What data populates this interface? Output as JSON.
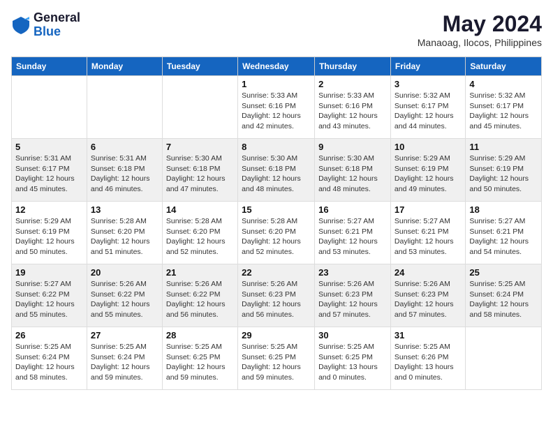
{
  "logo": {
    "general": "General",
    "blue": "Blue"
  },
  "title": "May 2024",
  "subtitle": "Manaoag, Ilocos, Philippines",
  "weekdays": [
    "Sunday",
    "Monday",
    "Tuesday",
    "Wednesday",
    "Thursday",
    "Friday",
    "Saturday"
  ],
  "rows": [
    [
      {
        "day": "",
        "info": ""
      },
      {
        "day": "",
        "info": ""
      },
      {
        "day": "",
        "info": ""
      },
      {
        "day": "1",
        "info": "Sunrise: 5:33 AM\nSunset: 6:16 PM\nDaylight: 12 hours and 42 minutes."
      },
      {
        "day": "2",
        "info": "Sunrise: 5:33 AM\nSunset: 6:16 PM\nDaylight: 12 hours and 43 minutes."
      },
      {
        "day": "3",
        "info": "Sunrise: 5:32 AM\nSunset: 6:17 PM\nDaylight: 12 hours and 44 minutes."
      },
      {
        "day": "4",
        "info": "Sunrise: 5:32 AM\nSunset: 6:17 PM\nDaylight: 12 hours and 45 minutes."
      }
    ],
    [
      {
        "day": "5",
        "info": "Sunrise: 5:31 AM\nSunset: 6:17 PM\nDaylight: 12 hours and 45 minutes."
      },
      {
        "day": "6",
        "info": "Sunrise: 5:31 AM\nSunset: 6:18 PM\nDaylight: 12 hours and 46 minutes."
      },
      {
        "day": "7",
        "info": "Sunrise: 5:30 AM\nSunset: 6:18 PM\nDaylight: 12 hours and 47 minutes."
      },
      {
        "day": "8",
        "info": "Sunrise: 5:30 AM\nSunset: 6:18 PM\nDaylight: 12 hours and 48 minutes."
      },
      {
        "day": "9",
        "info": "Sunrise: 5:30 AM\nSunset: 6:18 PM\nDaylight: 12 hours and 48 minutes."
      },
      {
        "day": "10",
        "info": "Sunrise: 5:29 AM\nSunset: 6:19 PM\nDaylight: 12 hours and 49 minutes."
      },
      {
        "day": "11",
        "info": "Sunrise: 5:29 AM\nSunset: 6:19 PM\nDaylight: 12 hours and 50 minutes."
      }
    ],
    [
      {
        "day": "12",
        "info": "Sunrise: 5:29 AM\nSunset: 6:19 PM\nDaylight: 12 hours and 50 minutes."
      },
      {
        "day": "13",
        "info": "Sunrise: 5:28 AM\nSunset: 6:20 PM\nDaylight: 12 hours and 51 minutes."
      },
      {
        "day": "14",
        "info": "Sunrise: 5:28 AM\nSunset: 6:20 PM\nDaylight: 12 hours and 52 minutes."
      },
      {
        "day": "15",
        "info": "Sunrise: 5:28 AM\nSunset: 6:20 PM\nDaylight: 12 hours and 52 minutes."
      },
      {
        "day": "16",
        "info": "Sunrise: 5:27 AM\nSunset: 6:21 PM\nDaylight: 12 hours and 53 minutes."
      },
      {
        "day": "17",
        "info": "Sunrise: 5:27 AM\nSunset: 6:21 PM\nDaylight: 12 hours and 53 minutes."
      },
      {
        "day": "18",
        "info": "Sunrise: 5:27 AM\nSunset: 6:21 PM\nDaylight: 12 hours and 54 minutes."
      }
    ],
    [
      {
        "day": "19",
        "info": "Sunrise: 5:27 AM\nSunset: 6:22 PM\nDaylight: 12 hours and 55 minutes."
      },
      {
        "day": "20",
        "info": "Sunrise: 5:26 AM\nSunset: 6:22 PM\nDaylight: 12 hours and 55 minutes."
      },
      {
        "day": "21",
        "info": "Sunrise: 5:26 AM\nSunset: 6:22 PM\nDaylight: 12 hours and 56 minutes."
      },
      {
        "day": "22",
        "info": "Sunrise: 5:26 AM\nSunset: 6:23 PM\nDaylight: 12 hours and 56 minutes."
      },
      {
        "day": "23",
        "info": "Sunrise: 5:26 AM\nSunset: 6:23 PM\nDaylight: 12 hours and 57 minutes."
      },
      {
        "day": "24",
        "info": "Sunrise: 5:26 AM\nSunset: 6:23 PM\nDaylight: 12 hours and 57 minutes."
      },
      {
        "day": "25",
        "info": "Sunrise: 5:25 AM\nSunset: 6:24 PM\nDaylight: 12 hours and 58 minutes."
      }
    ],
    [
      {
        "day": "26",
        "info": "Sunrise: 5:25 AM\nSunset: 6:24 PM\nDaylight: 12 hours and 58 minutes."
      },
      {
        "day": "27",
        "info": "Sunrise: 5:25 AM\nSunset: 6:24 PM\nDaylight: 12 hours and 59 minutes."
      },
      {
        "day": "28",
        "info": "Sunrise: 5:25 AM\nSunset: 6:25 PM\nDaylight: 12 hours and 59 minutes."
      },
      {
        "day": "29",
        "info": "Sunrise: 5:25 AM\nSunset: 6:25 PM\nDaylight: 12 hours and 59 minutes."
      },
      {
        "day": "30",
        "info": "Sunrise: 5:25 AM\nSunset: 6:25 PM\nDaylight: 13 hours and 0 minutes."
      },
      {
        "day": "31",
        "info": "Sunrise: 5:25 AM\nSunset: 6:26 PM\nDaylight: 13 hours and 0 minutes."
      },
      {
        "day": "",
        "info": ""
      }
    ]
  ]
}
